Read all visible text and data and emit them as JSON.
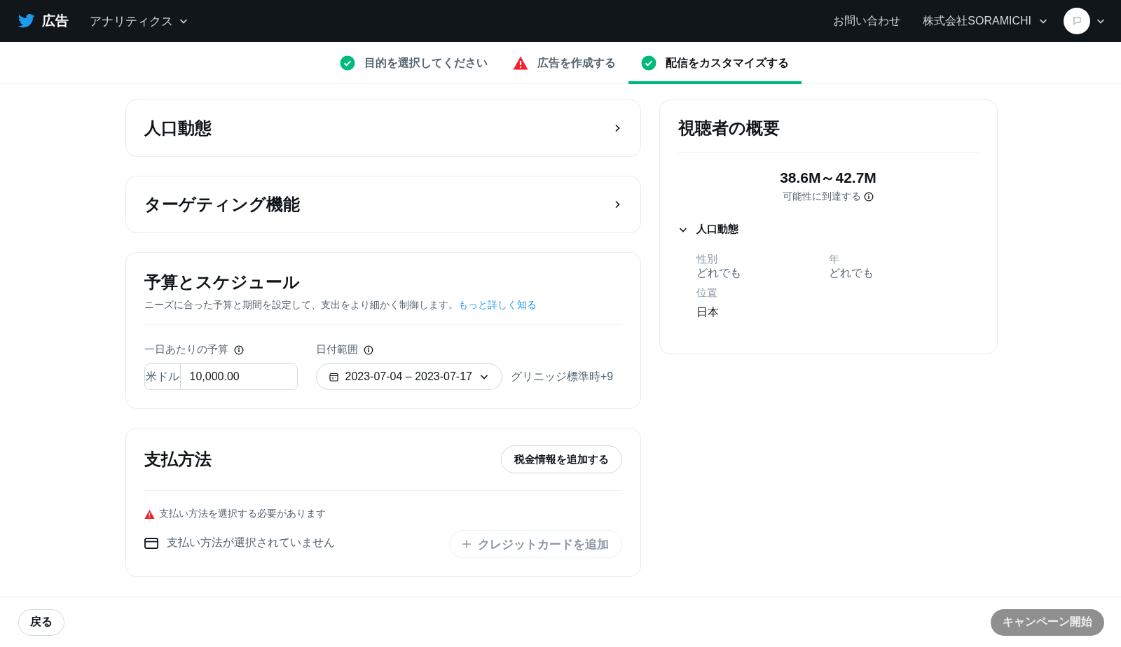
{
  "header": {
    "logo": "広告",
    "menu": "アナリティクス",
    "contact": "お問い合わせ",
    "account": "株式会社SORAMICHI"
  },
  "steps": [
    {
      "label": "目的を選択してください",
      "kind": "done",
      "selected": false
    },
    {
      "label": "広告を作成する",
      "kind": "warning",
      "selected": false
    },
    {
      "label": "配信をカスタマイズする",
      "kind": "done",
      "selected": true
    }
  ],
  "sections": [
    {
      "title": "人口動態",
      "expanded": false
    },
    {
      "title": "ターゲティング機能",
      "expanded": false
    }
  ],
  "budget": {
    "title": "予算とスケジュール",
    "description": "ニーズに合った予算と期間を設定して、支出をより細かく制御します。",
    "link": "もっと詳しく知る",
    "daily_budget_label": "一日あたりの予算",
    "currency": "米ドル",
    "amount": "10,000.00",
    "date_range_label": "日付範囲",
    "date_range": "2023-07-04 – 2023-07-17",
    "timezone": "グリニッジ標準時+9"
  },
  "payment": {
    "title": "支払方法",
    "tax_button": "税金情報を追加する",
    "warning": "支払い方法を選択する必要があります",
    "empty_text": "支払い方法が選択されていません",
    "add_card": {
      "label": "クレジットカードを追加",
      "disabled": true
    }
  },
  "audience": {
    "title": "視聴者の概要",
    "reach": "38.6M～42.7M",
    "reach_label": "可能性に到達する",
    "group": {
      "title": "人口動態",
      "expanded": true
    },
    "fields": [
      {
        "label": "性別",
        "value": "どれでも"
      },
      {
        "label": "年",
        "value": "どれでも"
      },
      {
        "label": "位置",
        "value": "日本"
      }
    ]
  },
  "footer": {
    "back": "戻る",
    "launch": {
      "label": "キャンペーン開始",
      "disabled": true
    }
  }
}
